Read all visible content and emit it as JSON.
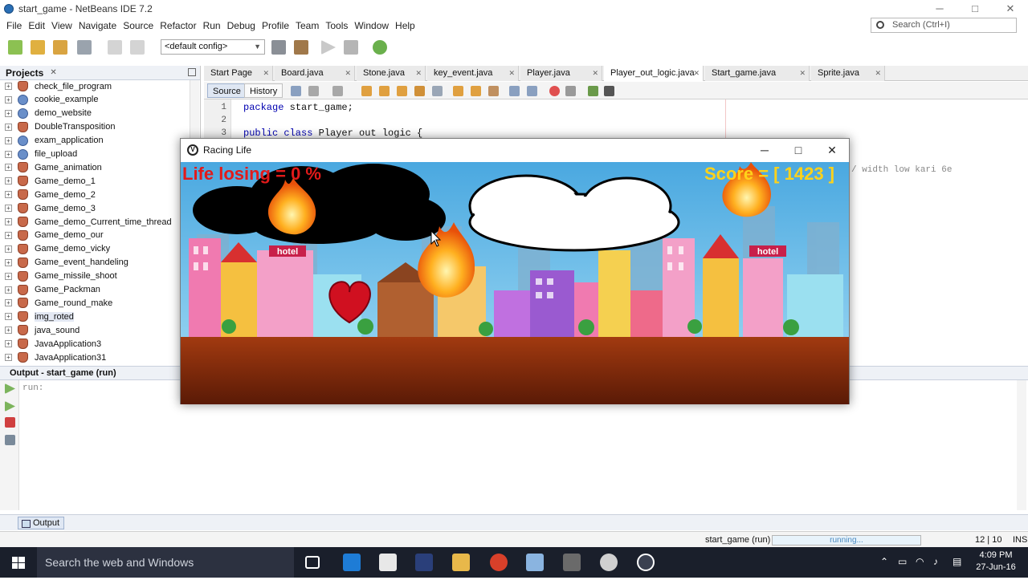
{
  "window": {
    "title": "start_game - NetBeans IDE 7.2",
    "minimize": "─",
    "maximize": "□",
    "close": "✕"
  },
  "menu": [
    "File",
    "Edit",
    "View",
    "Navigate",
    "Source",
    "Refactor",
    "Run",
    "Debug",
    "Profile",
    "Team",
    "Tools",
    "Window",
    "Help"
  ],
  "search": {
    "placeholder": "Search (Ctrl+I)"
  },
  "toolbar": {
    "config": "<default config>"
  },
  "projects": {
    "title": "Projects",
    "items": [
      {
        "label": "check_file_program",
        "icon": "cup"
      },
      {
        "label": "cookie_example",
        "icon": "globe"
      },
      {
        "label": "demo_website",
        "icon": "globe"
      },
      {
        "label": "DoubleTransposition",
        "icon": "cup"
      },
      {
        "label": "exam_application",
        "icon": "globe"
      },
      {
        "label": "file_upload",
        "icon": "globe"
      },
      {
        "label": "Game_animation",
        "icon": "cup"
      },
      {
        "label": "Game_demo_1",
        "icon": "cup"
      },
      {
        "label": "Game_demo_2",
        "icon": "cup"
      },
      {
        "label": "Game_demo_3",
        "icon": "cup"
      },
      {
        "label": "Game_demo_Current_time_thread",
        "icon": "cup"
      },
      {
        "label": "Game_demo_our",
        "icon": "cup"
      },
      {
        "label": "Game_demo_vicky",
        "icon": "cup"
      },
      {
        "label": "Game_event_handeling",
        "icon": "cup"
      },
      {
        "label": "Game_missile_shoot",
        "icon": "cup"
      },
      {
        "label": "Game_Packman",
        "icon": "cup"
      },
      {
        "label": "Game_round_make",
        "icon": "cup"
      },
      {
        "label": "img_roted",
        "icon": "cup"
      },
      {
        "label": "java_sound",
        "icon": "cup"
      },
      {
        "label": "JavaApplication3",
        "icon": "cup"
      },
      {
        "label": "JavaApplication31",
        "icon": "cup"
      }
    ]
  },
  "editor": {
    "tabs": [
      "Start Page",
      "Board.java",
      "Stone.java",
      "key_event.java",
      "Player.java",
      "Player_out_logic.java",
      "Start_game.java",
      "Sprite.java"
    ],
    "active_tab": "Player_out_logic.java",
    "source_label": "Source",
    "history_label": "History",
    "line_numbers": [
      "1",
      "2",
      "3"
    ],
    "code": {
      "line1_kw": "package",
      "line1_rest": " start_game;",
      "line3_kw": "public class",
      "line3_rest": " Player out logic {"
    },
    "comment_fragment": "/ width low kari 6e"
  },
  "output": {
    "title": "Output - start_game (run)",
    "run_text": "run:",
    "tab_label": "Output"
  },
  "status": {
    "task": "start_game (run)",
    "progress": "running...",
    "position": "12 | 10",
    "mode": "INS"
  },
  "game": {
    "title": "Racing Life",
    "minimize": "─",
    "maximize": "□",
    "close": "✕",
    "life_text": "Life losing = 0 %",
    "score_text": "Score = [ 1423 ]",
    "hotel_sign": "hotel"
  },
  "taskbar": {
    "search": "Search the web and Windows",
    "time": "4:09 PM",
    "date": "27-Jun-16"
  }
}
